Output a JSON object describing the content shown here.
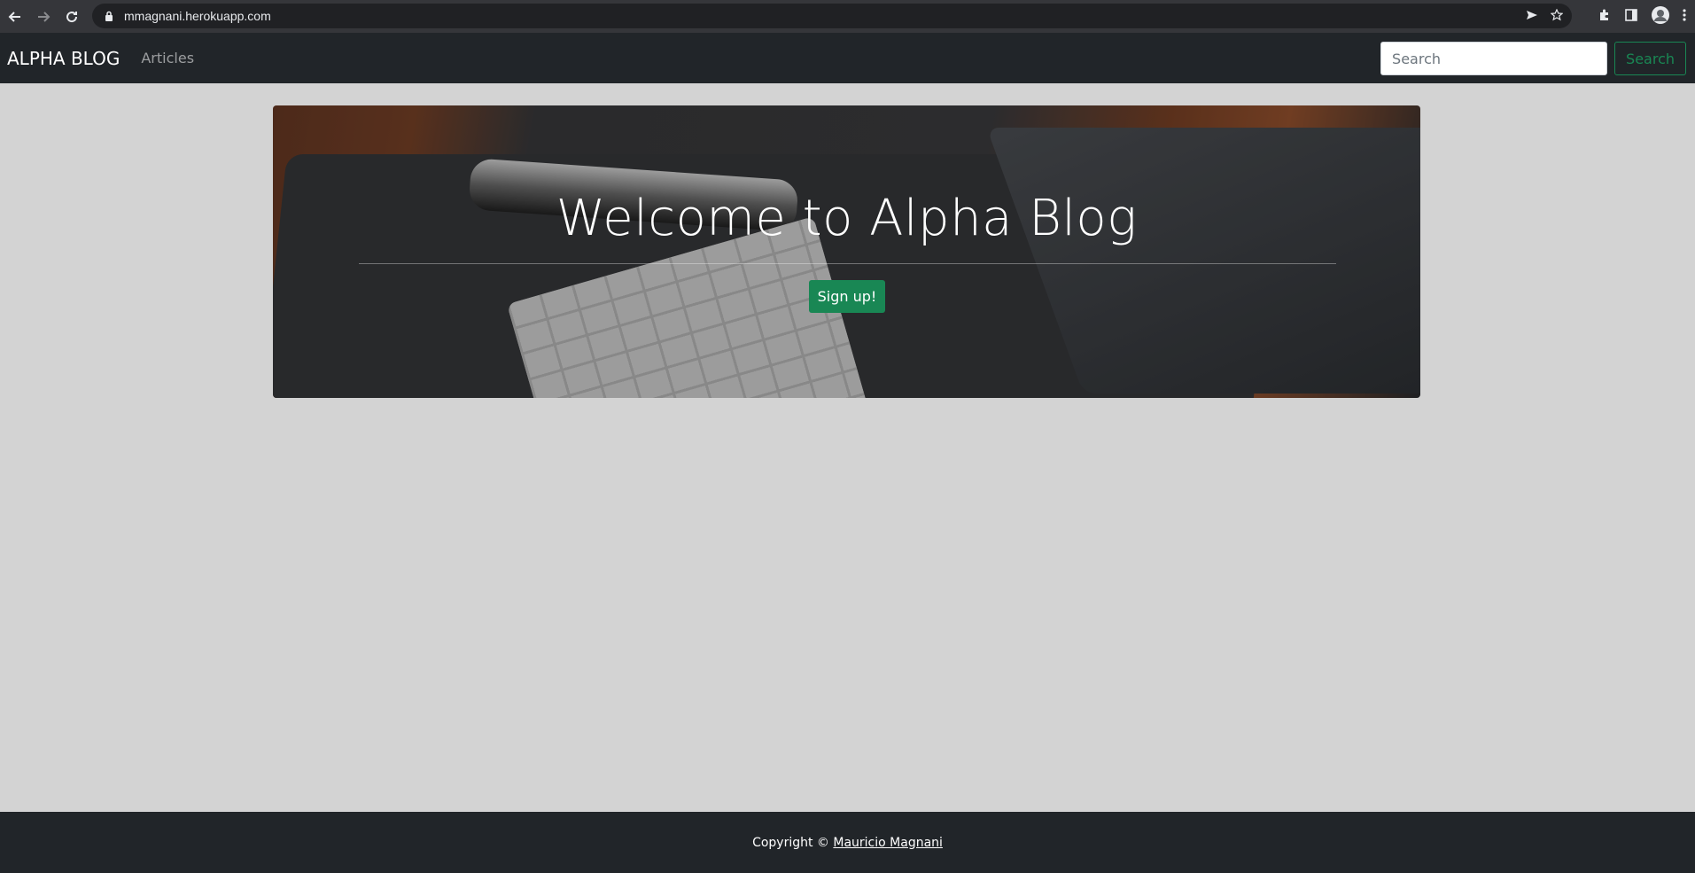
{
  "browser": {
    "url": "mmagnani.herokuapp.com",
    "icons": {
      "back": "arrow-left-icon",
      "forward": "arrow-right-icon",
      "reload": "reload-icon",
      "lock": "lock-icon",
      "share": "send-icon",
      "bookmark": "star-icon",
      "extensions": "puzzle-icon",
      "sidepanel": "side-panel-icon",
      "profile": "avatar-icon",
      "menu": "kebab-menu-icon"
    }
  },
  "navbar": {
    "brand": "ALPHA BLOG",
    "links": [
      {
        "label": "Articles"
      }
    ],
    "search_placeholder": "Search",
    "search_button": "Search"
  },
  "hero": {
    "title": "Welcome to Alpha Blog",
    "cta": "Sign up!"
  },
  "footer": {
    "prefix": "Copyright ©",
    "author": "Mauricio Magnani"
  },
  "colors": {
    "navbar_bg": "#212529",
    "page_bg": "#d3d3d3",
    "accent_green": "#198754"
  }
}
